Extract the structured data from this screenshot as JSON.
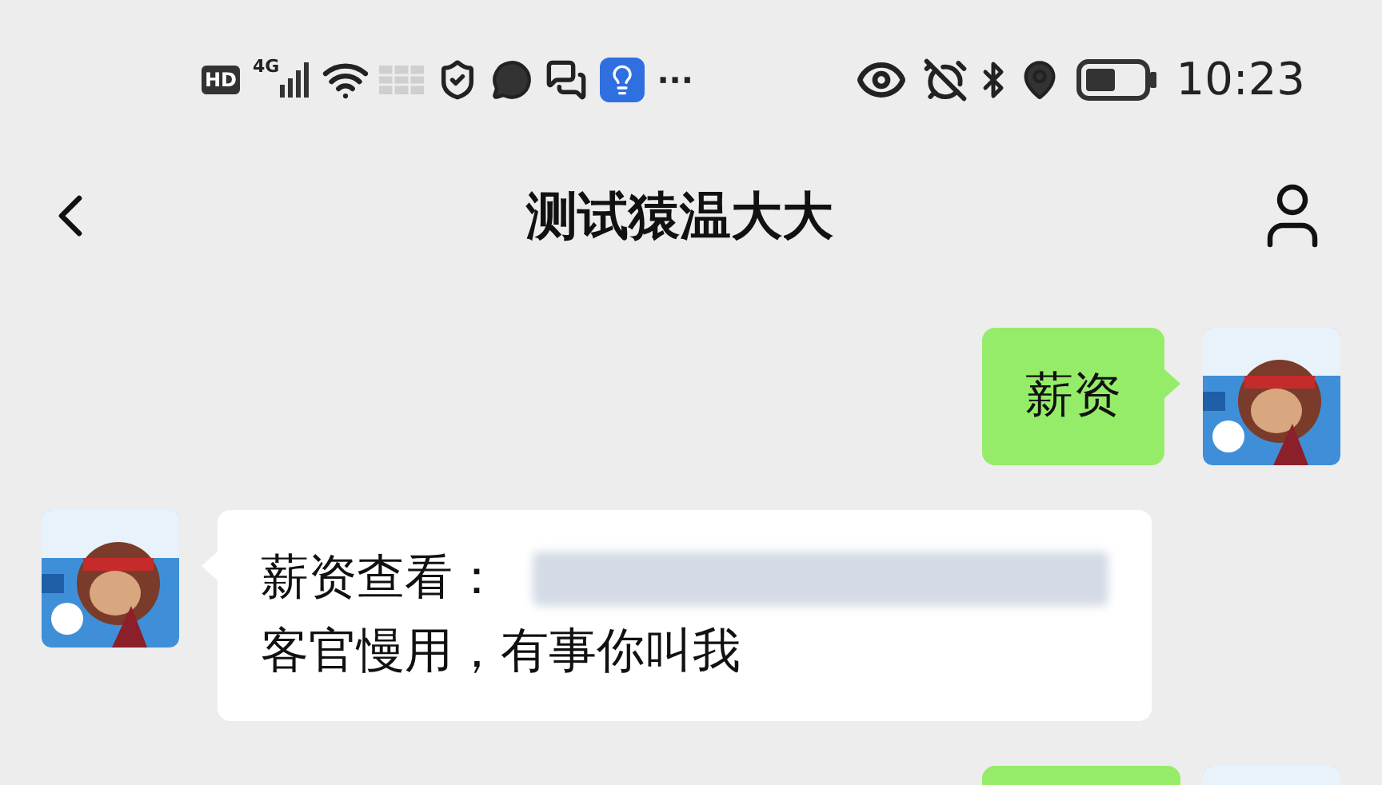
{
  "status_bar": {
    "hd": "HD",
    "network": "4G",
    "more": "···",
    "time": "10:23"
  },
  "title": "测试猿温大大",
  "messages": [
    {
      "kind": "sent",
      "lines": [
        "薪资"
      ],
      "redacted": false,
      "cut_off": false
    },
    {
      "kind": "received",
      "lines": [
        "薪资查看：",
        "客官慢用，有事你叫我"
      ],
      "redacted": true,
      "cut_off": false
    },
    {
      "kind": "sent",
      "cut_off": true
    }
  ]
}
